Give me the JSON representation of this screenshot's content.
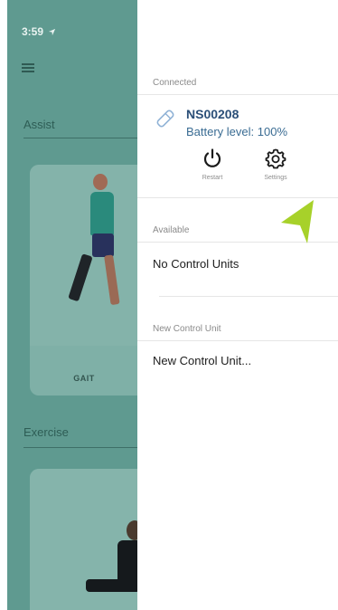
{
  "status_bar": {
    "time": "3:59"
  },
  "background_app": {
    "sections": [
      {
        "title": "Assist",
        "card_label": "GAIT"
      },
      {
        "title": "Exercise"
      }
    ]
  },
  "drawer": {
    "connected": {
      "heading": "Connected",
      "device_name": "NS00208",
      "battery": "Battery level: 100%",
      "actions": {
        "restart": "Restart",
        "settings": "Settings"
      }
    },
    "available": {
      "heading": "Available",
      "item": "No Control Units"
    },
    "new_unit": {
      "heading": "New Control Unit",
      "item": "New Control Unit..."
    }
  },
  "colors": {
    "teal_underlay": "#5f9a90",
    "device_name": "#2b4f78",
    "pointer": "#a7d12a"
  },
  "icons": [
    "location-arrow-icon",
    "hamburger-menu-icon",
    "pen-device-icon",
    "restart-icon",
    "settings-gear-icon",
    "pointer-arrow-icon"
  ]
}
